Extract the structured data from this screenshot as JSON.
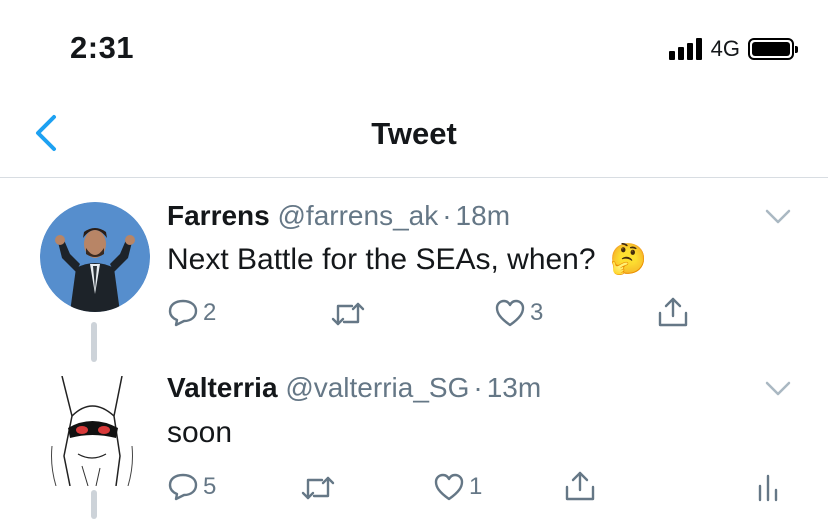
{
  "status_bar": {
    "time": "2:31",
    "network": "4G"
  },
  "nav": {
    "title": "Tweet",
    "back_icon": "chevron-left-icon"
  },
  "colors": {
    "accent": "#1da1f2",
    "muted": "#657786",
    "text": "#14171a",
    "divider": "#d8dde2"
  },
  "tweets": [
    {
      "name": "Farrens",
      "handle": "@farrens_ak",
      "separator": "·",
      "time": "18m",
      "text": "Next Battle for the SEAs, when?",
      "emoji": "🤔",
      "replies": "2",
      "retweets": "",
      "likes": "3"
    },
    {
      "name": "Valterria",
      "handle": "@valterria_SG",
      "separator": "·",
      "time": "13m",
      "text": "soon",
      "replies": "5",
      "retweets": "",
      "likes": "1"
    }
  ]
}
